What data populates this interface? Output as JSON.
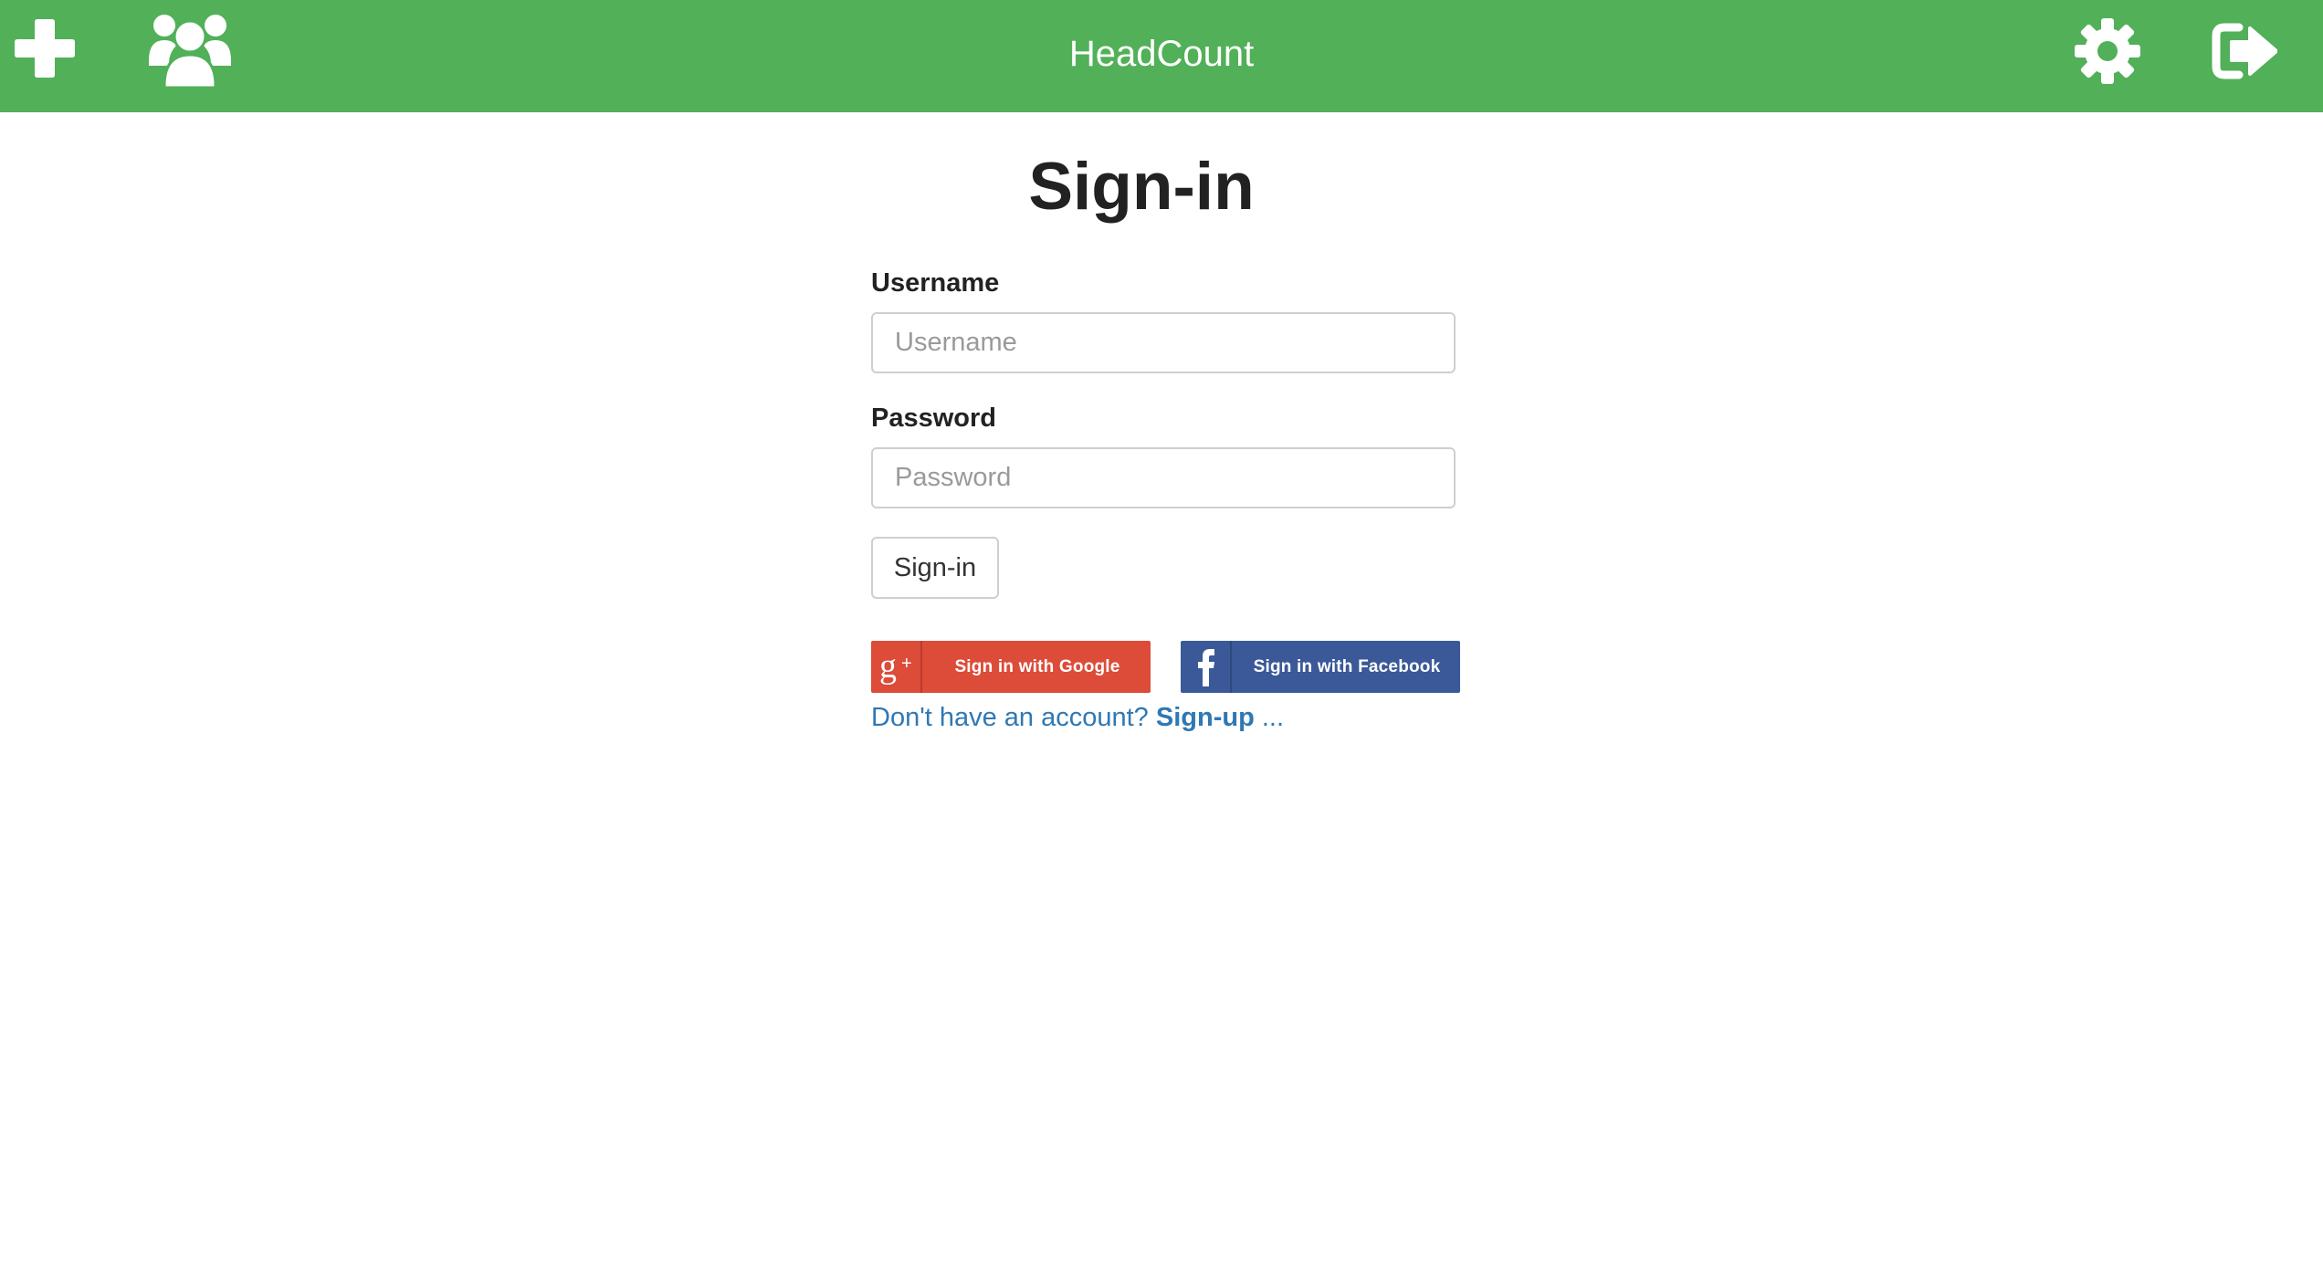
{
  "app": {
    "title": "HeadCount"
  },
  "nav": {
    "left_icons": [
      "add-icon",
      "users-icon"
    ],
    "right_icons": [
      "settings-icon",
      "sign-out-icon"
    ]
  },
  "page": {
    "title": "Sign-in"
  },
  "form": {
    "username": {
      "label": "Username",
      "placeholder": "Username",
      "value": ""
    },
    "password": {
      "label": "Password",
      "placeholder": "Password",
      "value": ""
    },
    "submit_label": "Sign-in"
  },
  "social": {
    "google_label": "Sign in with Google",
    "google_icon": "google-plus-icon",
    "facebook_label": "Sign in with Facebook",
    "facebook_icon": "facebook-icon"
  },
  "signup": {
    "prompt": "Don't have an account? ",
    "link_label": "Sign-up",
    "suffix": " ..."
  },
  "colors": {
    "topbar": "#51b058",
    "google": "#dd4b39",
    "facebook": "#3b5998",
    "link": "#2f78b4"
  }
}
